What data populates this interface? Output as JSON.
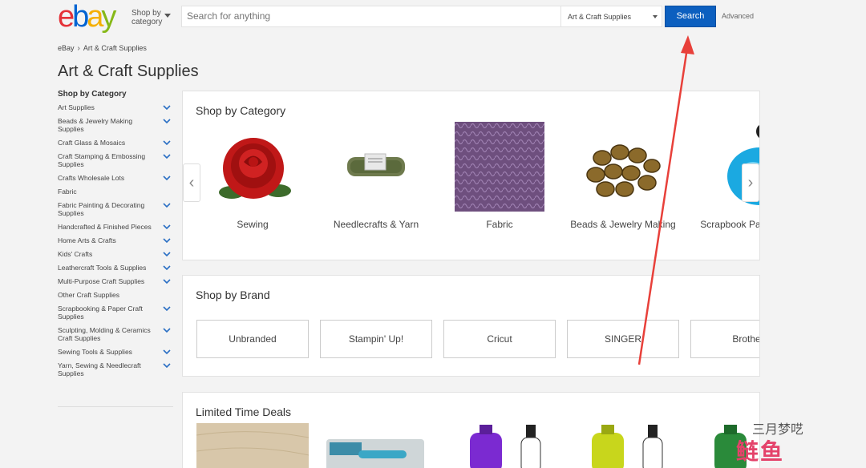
{
  "header": {
    "logo": {
      "e": "e",
      "b": "b",
      "a": "a",
      "y": "y",
      "colors": [
        "#e53238",
        "#0064d2",
        "#f5af02",
        "#86b817"
      ]
    },
    "shop_by_line1": "Shop by",
    "shop_by_line2": "category",
    "search_placeholder": "Search for anything",
    "search_category": "Art & Craft Supplies",
    "search_button": "Search",
    "advanced": "Advanced"
  },
  "breadcrumb": {
    "home": "eBay",
    "current": "Art & Craft Supplies"
  },
  "page_title": "Art & Craft Supplies",
  "sidebar": {
    "title": "Shop by Category",
    "items": [
      {
        "label": "Art Supplies",
        "expandable": true
      },
      {
        "label": "Beads & Jewelry Making Supplies",
        "expandable": true
      },
      {
        "label": "Craft Glass & Mosaics",
        "expandable": true
      },
      {
        "label": "Craft Stamping & Embossing Supplies",
        "expandable": true
      },
      {
        "label": "Crafts Wholesale Lots",
        "expandable": true
      },
      {
        "label": "Fabric",
        "expandable": false
      },
      {
        "label": "Fabric Painting & Decorating Supplies",
        "expandable": true
      },
      {
        "label": "Handcrafted & Finished Pieces",
        "expandable": true
      },
      {
        "label": "Home Arts & Crafts",
        "expandable": true
      },
      {
        "label": "Kids' Crafts",
        "expandable": true
      },
      {
        "label": "Leathercraft Tools & Supplies",
        "expandable": true
      },
      {
        "label": "Multi-Purpose Craft Supplies",
        "expandable": true
      },
      {
        "label": "Other Craft Supplies",
        "expandable": false
      },
      {
        "label": "Scrapbooking & Paper Craft Supplies",
        "expandable": true
      },
      {
        "label": "Sculpting, Molding & Ceramics Craft Supplies",
        "expandable": true
      },
      {
        "label": "Sewing Tools & Supplies",
        "expandable": true
      },
      {
        "label": "Yarn, Sewing & Needlecraft Supplies",
        "expandable": true
      }
    ]
  },
  "category_section": {
    "title": "Shop by Category",
    "items": [
      {
        "label": "Sewing",
        "icon": "rose-patch-icon"
      },
      {
        "label": "Needlecrafts & Yarn",
        "icon": "yarn-skein-icon"
      },
      {
        "label": "Fabric",
        "icon": "fabric-swatch-icon"
      },
      {
        "label": "Beads & Jewelry Making",
        "icon": "beads-icon"
      },
      {
        "label": "Scrapbook Paper Cra",
        "icon": "punch-tool-icon"
      }
    ]
  },
  "brand_section": {
    "title": "Shop by Brand",
    "brands": [
      "Unbranded",
      "Stampin' Up!",
      "Cricut",
      "SINGER",
      "Brothe"
    ]
  },
  "deals_section": {
    "title": "Limited Time Deals"
  },
  "watermark": {
    "line1": "三月梦呓",
    "line2": "鲢鱼"
  },
  "colors": {
    "accent": "#0c5fbf",
    "annotation": "#e8403a"
  }
}
